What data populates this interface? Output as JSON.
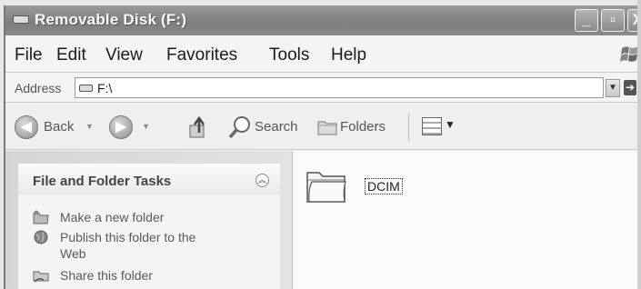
{
  "window": {
    "title": "Removable Disk (F:)",
    "controls": {
      "minimize": "_",
      "maximize": "▫",
      "close": "X"
    }
  },
  "menu": [
    "File",
    "Edit",
    "View",
    "Favorites",
    "Tools",
    "Help"
  ],
  "address": {
    "label": "Address",
    "value": "F:\\",
    "go_label": "Go"
  },
  "toolbar": {
    "back_label": "Back",
    "search_label": "Search",
    "folders_label": "Folders",
    "back_icon": "left-arrow-icon",
    "forward_icon": "right-arrow-icon",
    "up_icon": "folder-up-icon",
    "views_icon": "views-icon"
  },
  "tasks": {
    "title": "File and Folder Tasks",
    "items": [
      {
        "label": "Make a new folder",
        "icon": "new-folder-icon"
      },
      {
        "label": "Publish this folder to the Web",
        "icon": "globe-icon"
      },
      {
        "label": "Share this folder",
        "icon": "share-folder-icon"
      }
    ]
  },
  "content": {
    "items": [
      {
        "name": "DCIM",
        "type": "folder"
      }
    ]
  },
  "colors": {
    "titlebar": "#8a8a8a",
    "pane": "#dcdcdc",
    "background": "#fbfbfb"
  }
}
